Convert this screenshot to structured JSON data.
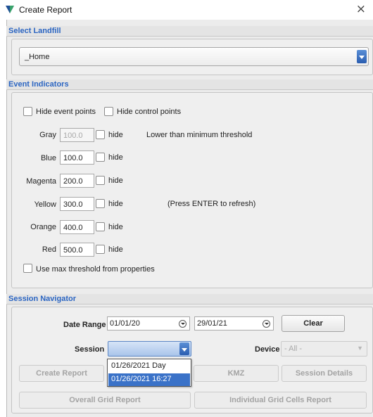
{
  "window": {
    "title": "Create Report",
    "close_glyph": "×"
  },
  "sections": {
    "landfill": "Select Landfill",
    "events": "Event Indicators",
    "navigator": "Session Navigator"
  },
  "landfill": {
    "selected": "_Home"
  },
  "event_indicators": {
    "hide_event_points": "Hide event points",
    "hide_control_points": "Hide control points",
    "hide_label": "hide",
    "thresholds": [
      {
        "color": "Gray",
        "value": "100.0",
        "note": "Lower than minimum threshold"
      },
      {
        "color": "Blue",
        "value": "100.0",
        "note": ""
      },
      {
        "color": "Magenta",
        "value": "200.0",
        "note": ""
      },
      {
        "color": "Yellow",
        "value": "300.0",
        "note": "(Press ENTER to refresh)"
      },
      {
        "color": "Orange",
        "value": "400.0",
        "note": ""
      },
      {
        "color": "Red",
        "value": "500.0",
        "note": ""
      }
    ],
    "use_max_threshold": "Use max threshold from properties"
  },
  "navigator": {
    "date_range_label": "Date Range",
    "date_from": "01/01/20",
    "date_to": "29/01/21",
    "clear": "Clear",
    "session_label": "Session",
    "session_value": "",
    "device_label": "Device",
    "device_value": "- All -",
    "session_options": [
      "01/26/2021 Day",
      "01/26/2021 16:27"
    ],
    "buttons": {
      "create_report": "Create Report",
      "kmz": "KMZ",
      "session_details": "Session Details",
      "overall_grid": "Overall Grid Report",
      "individual_grid": "Individual Grid Cells Report"
    }
  },
  "colors": {
    "accent": "#2b65c2",
    "selection": "#3a72c8",
    "app_icon": "#1f4f96"
  }
}
